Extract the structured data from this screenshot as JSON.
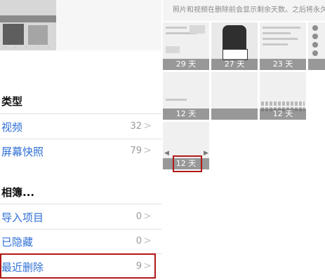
{
  "left_panel": {
    "section_types": {
      "title": "类型",
      "items": [
        {
          "label": "视频",
          "count": "32",
          "chevron": ">"
        },
        {
          "label": "屏幕快照",
          "count": "79",
          "chevron": ">"
        }
      ]
    },
    "section_albums": {
      "title": "相簿...",
      "items": [
        {
          "label": "导入项目",
          "count": "0",
          "chevron": ">"
        },
        {
          "label": "已隐藏",
          "count": "0",
          "chevron": ">"
        },
        {
          "label": "最近删除",
          "count": "9",
          "chevron": ">"
        }
      ]
    }
  },
  "right_panel": {
    "notice": "照片和视频在删除前会显示剩余天数。之后将永久删",
    "cells": [
      {
        "days_label": "29 天"
      },
      {
        "days_label": "27 天"
      },
      {
        "days_label": "23 天"
      },
      {
        "days_label": ""
      },
      {
        "days_label": "12 天"
      },
      {
        "days_label": ""
      },
      {
        "days_label": "12 天"
      },
      {
        "days_label": "12 天"
      }
    ]
  },
  "colors": {
    "link_blue": "#2f6fd6",
    "highlight_red": "#b01818"
  }
}
